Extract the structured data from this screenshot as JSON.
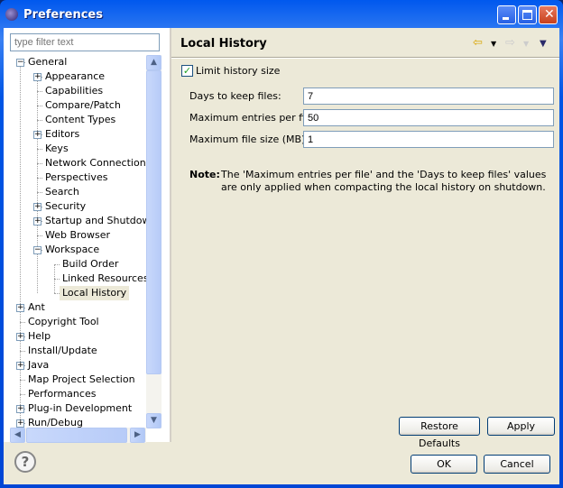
{
  "window": {
    "title": "Preferences"
  },
  "filter": {
    "placeholder": "type filter text"
  },
  "tree": [
    {
      "label": "General",
      "level": 0,
      "expander": "minus"
    },
    {
      "label": "Appearance",
      "level": 1,
      "expander": "plus"
    },
    {
      "label": "Capabilities",
      "level": 1
    },
    {
      "label": "Compare/Patch",
      "level": 1
    },
    {
      "label": "Content Types",
      "level": 1
    },
    {
      "label": "Editors",
      "level": 1,
      "expander": "plus"
    },
    {
      "label": "Keys",
      "level": 1
    },
    {
      "label": "Network Connections",
      "level": 1
    },
    {
      "label": "Perspectives",
      "level": 1
    },
    {
      "label": "Search",
      "level": 1
    },
    {
      "label": "Security",
      "level": 1,
      "expander": "plus"
    },
    {
      "label": "Startup and Shutdown",
      "level": 1,
      "expander": "plus"
    },
    {
      "label": "Web Browser",
      "level": 1
    },
    {
      "label": "Workspace",
      "level": 1,
      "expander": "minus"
    },
    {
      "label": "Build Order",
      "level": 2
    },
    {
      "label": "Linked Resources",
      "level": 2
    },
    {
      "label": "Local History",
      "level": 2,
      "selected": true
    },
    {
      "label": "Ant",
      "level": 0,
      "expander": "plus"
    },
    {
      "label": "Copyright Tool",
      "level": 0
    },
    {
      "label": "Help",
      "level": 0,
      "expander": "plus"
    },
    {
      "label": "Install/Update",
      "level": 0
    },
    {
      "label": "Java",
      "level": 0,
      "expander": "plus"
    },
    {
      "label": "Map Project Selection",
      "level": 0
    },
    {
      "label": "Performances",
      "level": 0
    },
    {
      "label": "Plug-in Development",
      "level": 0,
      "expander": "plus"
    },
    {
      "label": "Run/Debug",
      "level": 0,
      "expander": "plus"
    }
  ],
  "page": {
    "title": "Local History",
    "limit_label": "Limit history size",
    "limit_checked": true,
    "fields": [
      {
        "label": "Days to keep files:",
        "value": "7"
      },
      {
        "label": "Maximum entries per file:",
        "value": "50"
      },
      {
        "label": "Maximum file size (MB):",
        "value": "1"
      }
    ],
    "note_label": "Note:",
    "note_line1": "The 'Maximum entries per file' and the 'Days to keep files' values",
    "note_line2": "are only applied when compacting the local history on shutdown.",
    "restore_defaults": "Restore Defaults",
    "apply": "Apply"
  },
  "footer": {
    "ok": "OK",
    "cancel": "Cancel"
  },
  "colors": {
    "titlebar": "#0058ee",
    "panel": "#ece9d8",
    "selection": "#ece9d8"
  }
}
